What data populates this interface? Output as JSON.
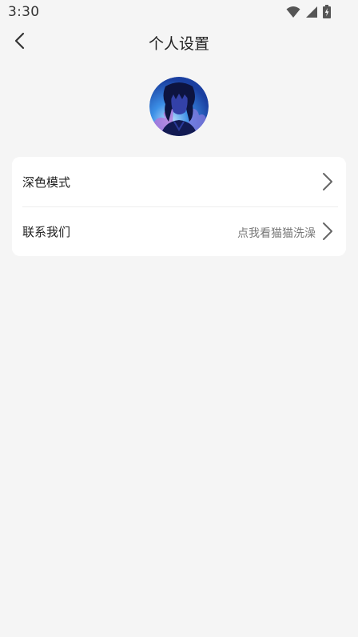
{
  "status_bar": {
    "time": "3:30",
    "icons": [
      "wifi-icon",
      "cellular-signal-icon",
      "battery-charging-icon"
    ]
  },
  "header": {
    "back_icon": "chevron-left-icon",
    "title": "个人设置"
  },
  "avatar": {
    "icon": "avatar-anime-character"
  },
  "settings": {
    "dark_mode": {
      "label": "深色模式",
      "icon": "chevron-right-icon"
    },
    "contact": {
      "label": "联系我们",
      "value": "点我看猫猫洗澡",
      "icon": "chevron-right-icon"
    }
  },
  "colors": {
    "background": "#f5f5f5",
    "card": "#ffffff",
    "secondary_text": "#777777"
  }
}
